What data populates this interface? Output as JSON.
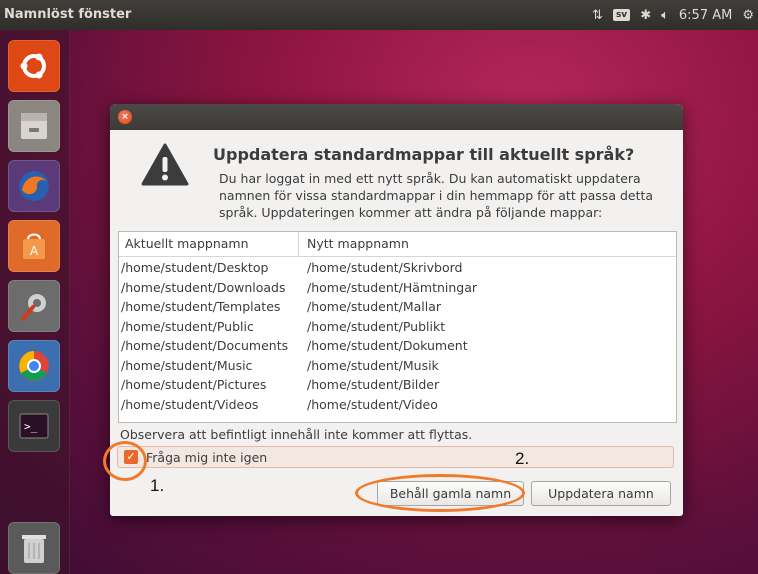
{
  "panel": {
    "window_title": "Namnlöst fönster",
    "keyboard": "sv",
    "time": "6:57 AM"
  },
  "launcher": {
    "items": [
      {
        "name": "ubuntu-dash-icon"
      },
      {
        "name": "files-icon"
      },
      {
        "name": "firefox-icon"
      },
      {
        "name": "software-center-icon"
      },
      {
        "name": "system-settings-icon"
      },
      {
        "name": "chrome-icon"
      },
      {
        "name": "terminal-icon"
      },
      {
        "name": "trash-icon"
      }
    ]
  },
  "dialog": {
    "heading": "Uppdatera standardmappar till aktuellt språk?",
    "description": "Du har loggat in med ett nytt språk. Du kan automatiskt uppdatera namnen för vissa standardmappar i din hemmapp för att passa detta språk. Uppdateringen kommer att ändra på följande mappar:",
    "columns": [
      "Aktuellt mappnamn",
      "Nytt mappnamn"
    ],
    "rows": [
      [
        "/home/student/Desktop",
        "/home/student/Skrivbord"
      ],
      [
        "/home/student/Downloads",
        "/home/student/Hämtningar"
      ],
      [
        "/home/student/Templates",
        "/home/student/Mallar"
      ],
      [
        "/home/student/Public",
        "/home/student/Publikt"
      ],
      [
        "/home/student/Documents",
        "/home/student/Dokument"
      ],
      [
        "/home/student/Music",
        "/home/student/Musik"
      ],
      [
        "/home/student/Pictures",
        "/home/student/Bilder"
      ],
      [
        "/home/student/Videos",
        "/home/student/Video"
      ]
    ],
    "note": "Observera att befintligt innehåll inte kommer att flyttas.",
    "checkbox_label": "Fråga mig inte igen",
    "checkbox_checked": true,
    "keep_button": "Behåll gamla namn",
    "update_button": "Uppdatera namn"
  },
  "annotations": {
    "step1": "1.",
    "step2": "2.",
    "color": "#f07a2a"
  }
}
